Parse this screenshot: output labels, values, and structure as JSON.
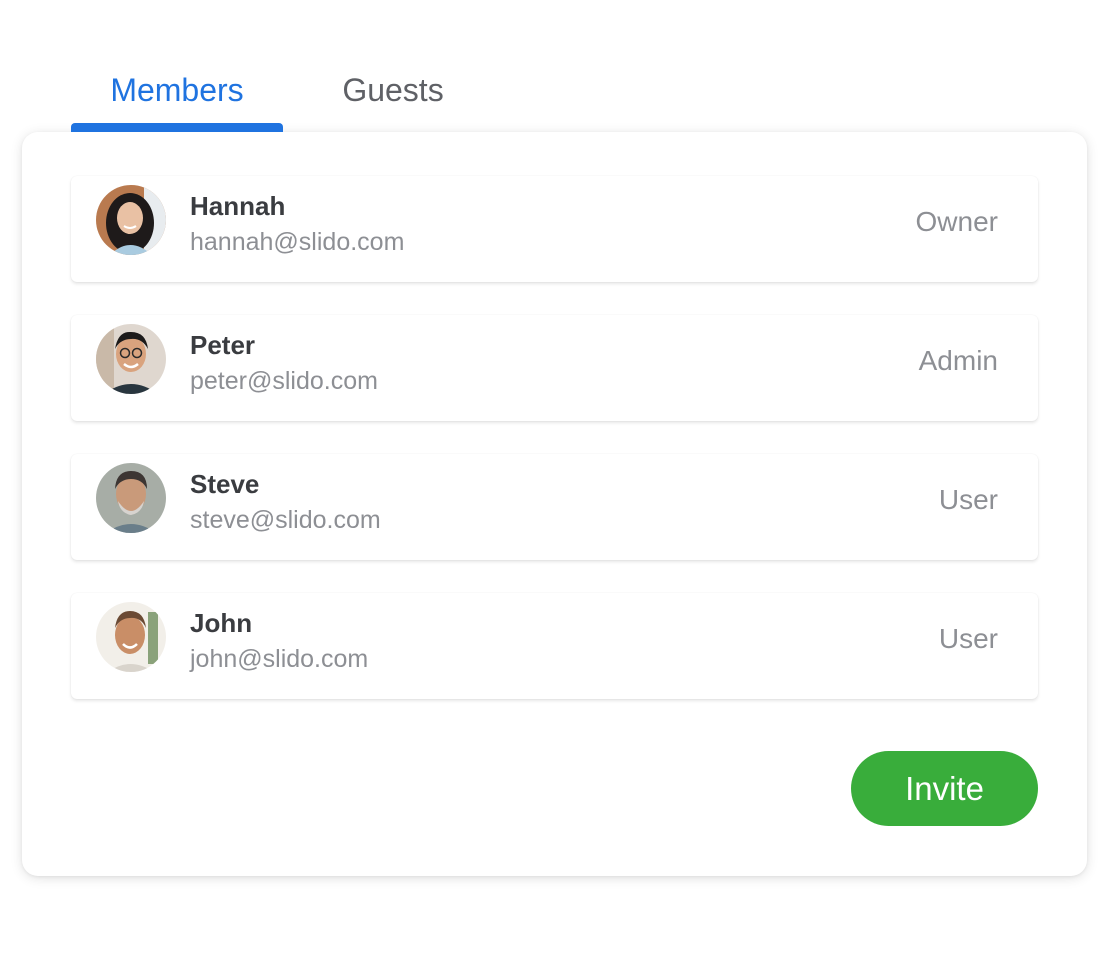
{
  "tabs": [
    {
      "label": "Members",
      "active": true
    },
    {
      "label": "Guests",
      "active": false
    }
  ],
  "members": [
    {
      "name": "Hannah",
      "email": "hannah@slido.com",
      "role": "Owner",
      "avatar": "avatar-hannah"
    },
    {
      "name": "Peter",
      "email": "peter@slido.com",
      "role": "Admin",
      "avatar": "avatar-peter"
    },
    {
      "name": "Steve",
      "email": "steve@slido.com",
      "role": "User",
      "avatar": "avatar-steve"
    },
    {
      "name": "John",
      "email": "john@slido.com",
      "role": "User",
      "avatar": "avatar-john"
    }
  ],
  "invite_label": "Invite",
  "colors": {
    "accent": "#1f73e0",
    "invite": "#39ad3b",
    "text_primary": "#3a3c40",
    "text_secondary": "#8d8f94"
  }
}
